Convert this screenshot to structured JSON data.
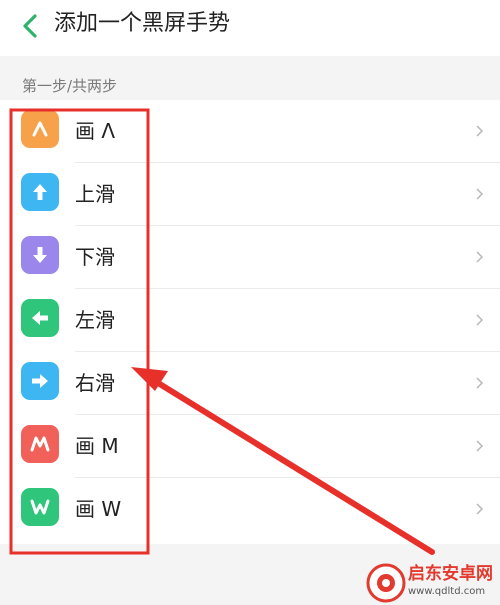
{
  "header": {
    "title": "添加一个黑屏手势",
    "back_icon": "chevron-left-icon",
    "back_color": "#2db36b"
  },
  "section": {
    "label": "第一步/共两步"
  },
  "gestures": [
    {
      "label": "画 Λ",
      "icon": "caret-up-glyph-icon",
      "color": "#f7a24a"
    },
    {
      "label": "上滑",
      "icon": "arrow-up-icon",
      "color": "#3db6f2"
    },
    {
      "label": "下滑",
      "icon": "arrow-down-icon",
      "color": "#9b86ec"
    },
    {
      "label": "左滑",
      "icon": "arrow-left-icon",
      "color": "#2fc57a"
    },
    {
      "label": "右滑",
      "icon": "arrow-right-icon",
      "color": "#3db6f2"
    },
    {
      "label": "画 M",
      "icon": "letter-m-icon",
      "color": "#f26159"
    },
    {
      "label": "画 W",
      "icon": "letter-w-icon",
      "color": "#2fc57a"
    }
  ],
  "annotation": {
    "color": "#e8302a"
  },
  "watermark": {
    "title": "启东安卓网",
    "url": "www.qdltd.com"
  }
}
